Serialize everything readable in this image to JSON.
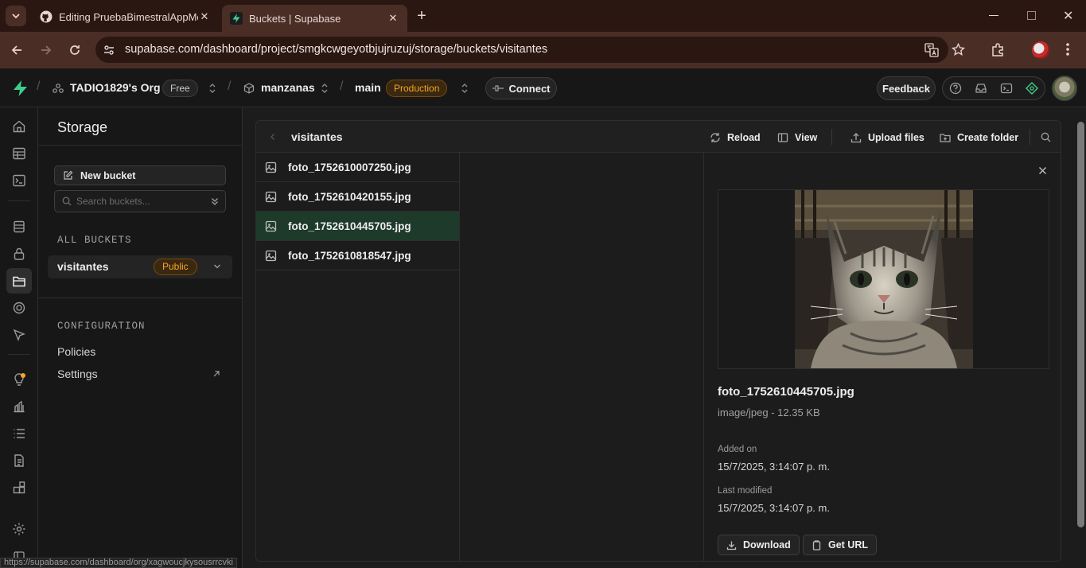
{
  "browser": {
    "tabs": [
      {
        "title": "Editing PruebaBimestralAppMovil",
        "icon": "github-icon",
        "active": false
      },
      {
        "title": "Buckets | Supabase",
        "icon": "supabase-icon",
        "active": true
      }
    ],
    "url": "supabase.com/dashboard/project/smgkcwgeyotbjujruzuj/storage/buckets/visitantes",
    "status_url": "https://supabase.com/dashboard/org/xagwoucjkysousrrcvki"
  },
  "topbar": {
    "org": "TADIO1829's Org",
    "org_plan": "Free",
    "project": "manzanas",
    "branch": "main",
    "branch_env": "Production",
    "connect_label": "Connect",
    "feedback_label": "Feedback"
  },
  "rail": {
    "items": [
      "home-icon",
      "table-editor-icon",
      "sql-editor-icon",
      "database-icon",
      "auth-icon",
      "storage-icon",
      "edge-functions-icon",
      "realtime-icon",
      "advisors-icon",
      "reports-icon",
      "logs-icon",
      "api-docs-icon",
      "integrations-icon",
      "settings-icon"
    ]
  },
  "sidebar": {
    "title": "Storage",
    "new_bucket_label": "New bucket",
    "search_placeholder": "Search buckets...",
    "all_buckets_label": "ALL BUCKETS",
    "bucket": {
      "name": "visitantes",
      "badge": "Public"
    },
    "configuration_label": "CONFIGURATION",
    "links": [
      "Policies",
      "Settings"
    ]
  },
  "explorer": {
    "path": "visitantes",
    "actions": {
      "reload": "Reload",
      "view": "View",
      "upload": "Upload files",
      "create_folder": "Create folder"
    },
    "files": [
      "foto_1752610007250.jpg",
      "foto_1752610420155.jpg",
      "foto_1752610445705.jpg",
      "foto_1752610818547.jpg"
    ],
    "selected_index": 2
  },
  "preview": {
    "file_name": "foto_1752610445705.jpg",
    "file_info": "image/jpeg - 12.35 KB",
    "added_label": "Added on",
    "added_value": "15/7/2025, 3:14:07 p. m.",
    "modified_label": "Last modified",
    "modified_value": "15/7/2025, 3:14:07 p. m.",
    "download_label": "Download",
    "get_url_label": "Get URL"
  },
  "colors": {
    "brand": "#3ecf8e",
    "selected_row": "#1d3a2b",
    "badge_orange": "#f5a524"
  }
}
